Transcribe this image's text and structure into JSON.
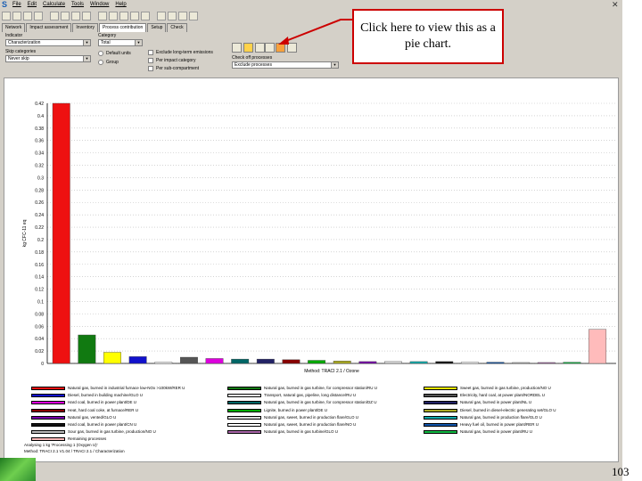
{
  "menubar": {
    "menus": [
      "File",
      "Edit",
      "Calculate",
      "Tools",
      "Window",
      "Help"
    ]
  },
  "tabs": [
    "Network",
    "Impact assessment",
    "Inventory",
    "Process contribution",
    "Setup",
    "Check"
  ],
  "controls": {
    "indicator_label": "Indicator",
    "indicator_value": "Characterization",
    "category_label": "Category",
    "category_value": "Total",
    "skip_label": "Skip categories",
    "skip_value": "Never skip",
    "default_units": "Default units",
    "group": "Group",
    "exclude_long_term": "Exclude long-term emissions",
    "per_impact_category": "Per impact category",
    "per_sub_compartment": "Per sub-compartment",
    "check_processes_label": "Check off processes",
    "check_processes_value": "Exclude processes"
  },
  "callout": {
    "text": "Click here to view this as a pie chart."
  },
  "page_number": "103",
  "chart_data": {
    "type": "bar",
    "ylabel": "kg CFC-11 eq",
    "xlabel": "Method: TRACI 2.1 / Ozone",
    "ylim": [
      0,
      0.42
    ],
    "yticks": [
      "0",
      "0.02",
      "0.04",
      "0.06",
      "0.08",
      "0.1",
      "0.12",
      "0.14",
      "0.16",
      "0.18",
      "0.2",
      "0.22",
      "0.24",
      "0.26",
      "0.28",
      "0.3",
      "0.32",
      "0.34",
      "0.36",
      "0.38",
      "0.4",
      "0.42"
    ],
    "series": [
      {
        "name": "Natural gas, burned in industrial furnace low-NOx >100kW/RER U",
        "color": "#ee1111",
        "value": 0.42
      },
      {
        "name": "Natural gas, burned in gas turbine, for compressor station/RU U",
        "color": "#117a11",
        "value": 0.046
      },
      {
        "name": "Sweet gas, burned in gas turbine, production/NO U",
        "color": "#ffff00",
        "value": 0.018
      },
      {
        "name": "Diesel, burned in building machine/GLO U",
        "color": "#1111cc",
        "value": 0.011
      },
      {
        "name": "Transport, natural gas, pipeline, long distance/RU U",
        "color": "#ffffff",
        "value": 0.002
      },
      {
        "name": "Electricity, hard coal, at power plant/NORDEL U",
        "color": "#555555",
        "value": 0.01
      },
      {
        "name": "Hard coal, burned in power plant/DE U",
        "color": "#dd00dd",
        "value": 0.008
      },
      {
        "name": "Natural gas, burned in gas turbine, for compressor station/DZ U",
        "color": "#006666",
        "value": 0.007
      },
      {
        "name": "Natural gas, burned in power plant/NL U",
        "color": "#222266",
        "value": 0.007
      },
      {
        "name": "Heat, hard coal coke, at furnace/RER U",
        "color": "#880000",
        "value": 0.006
      },
      {
        "name": "Lignite, burned in power plant/DE U",
        "color": "#00aa00",
        "value": 0.005
      },
      {
        "name": "Diesel, burned in diesel-electric generating set/GLO U",
        "color": "#aaaa22",
        "value": 0.004
      },
      {
        "name": "Natural gas, vented/GLO U",
        "color": "#7700aa",
        "value": 0.003
      },
      {
        "name": "Natural gas, sweet, burned in production flare/GLO U",
        "color": "#dddddd",
        "value": 0.003
      },
      {
        "name": "Natural gas, burned in production flare/GLO U",
        "color": "#11aaaa",
        "value": 0.003
      },
      {
        "name": "Hard coal, burned in power plant/CN U",
        "color": "#111111",
        "value": 0.003
      },
      {
        "name": "Natural gas, sweet, burned in production flare/NO U",
        "color": "#ffffff",
        "value": 0.002
      },
      {
        "name": "Heavy fuel oil, burned in power plant/RER U",
        "color": "#1155aa",
        "value": 0.002
      },
      {
        "name": "Sour gas, burned in gas turbine, production/NO U",
        "color": "#bbbbbb",
        "value": 0.0015
      },
      {
        "name": "Natural gas, burned in gas turbine/GLO U",
        "color": "#aa66aa",
        "value": 0.0015
      },
      {
        "name": "Natural gas, burned in power plant/RU U",
        "color": "#11bb44",
        "value": 0.002
      },
      {
        "name": "Remaining processes",
        "color": "#ffbbbb",
        "value": 0.055
      }
    ]
  },
  "footer": {
    "line1": "Analysing 1 kg 'Processing 1 (Oxygen U)'",
    "line2": "Method: TRACI 2.1 V1.04 / TRACI 2.1 / Characterization"
  }
}
